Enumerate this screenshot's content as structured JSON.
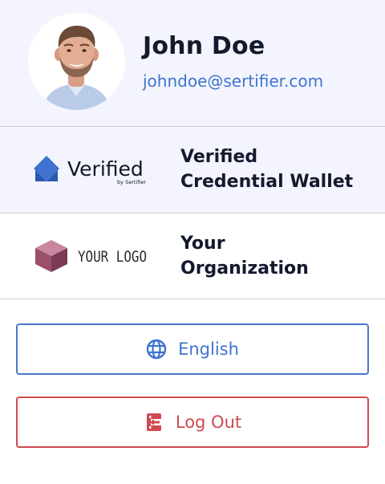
{
  "profile": {
    "name": "John Doe",
    "email": "johndoe@sertifier.com"
  },
  "wallet": {
    "logo_word": "Verified",
    "logo_sub": "by Sertifier",
    "title_line1": "Verified",
    "title_line2": "Credential Wallet"
  },
  "organization": {
    "logo_text": "YOUR LOGO",
    "title_line1": "Your",
    "title_line2": "Organization"
  },
  "buttons": {
    "language_label": "English",
    "language_icon": "globe-icon",
    "logout_label": "Log Out",
    "logout_icon": "logout-icon"
  },
  "colors": {
    "accent_blue": "#3e74cf",
    "danger_red": "#cf4a50",
    "header_bg": "#f3f4fd"
  }
}
